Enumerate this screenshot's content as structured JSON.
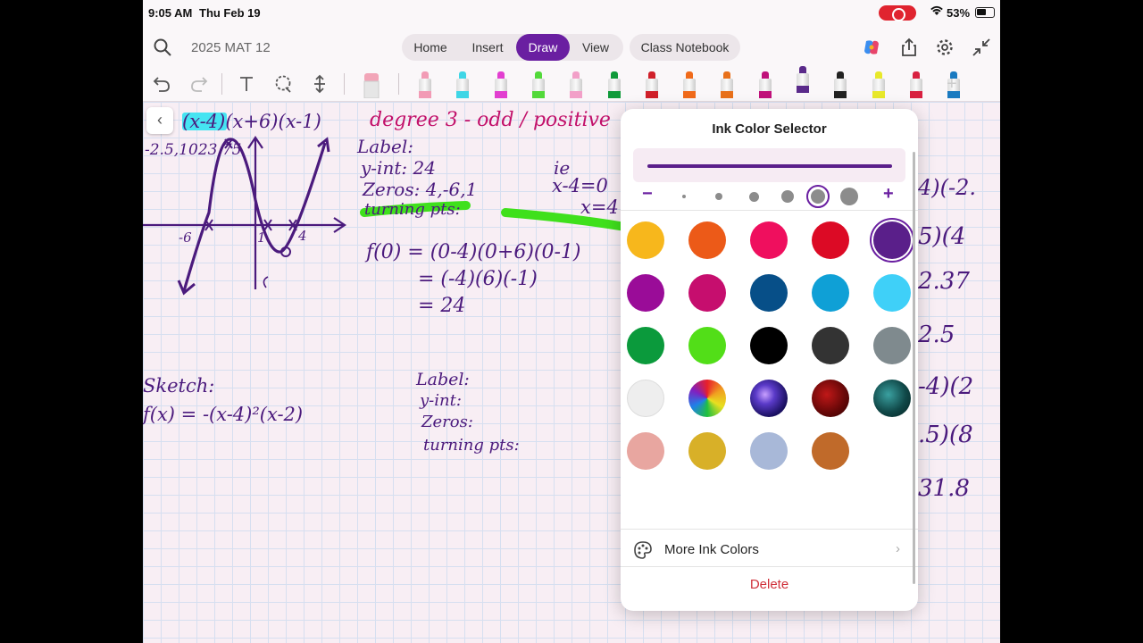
{
  "status": {
    "time": "9:05 AM",
    "date": "Thu Feb 19",
    "battery": "53%"
  },
  "header": {
    "notebook_title": "2025 MAT 12",
    "tabs": [
      {
        "label": "Home"
      },
      {
        "label": "Insert"
      },
      {
        "label": "Draw",
        "active": true
      },
      {
        "label": "View"
      }
    ],
    "class_notebook": "Class Notebook"
  },
  "toolbar": {
    "pens": [
      {
        "color": "#f29bb5"
      },
      {
        "color": "#3fd6e6"
      },
      {
        "color": "#e23fd0"
      },
      {
        "color": "#52d93a"
      },
      {
        "color": "#f2a0c8"
      },
      {
        "color": "#0f9a3a"
      },
      {
        "color": "#d0202a"
      },
      {
        "color": "#f06a1a"
      },
      {
        "color": "#e8701a"
      },
      {
        "color": "#c0107a"
      },
      {
        "color": "#5a2a8a",
        "selected": true
      },
      {
        "color": "#222222"
      },
      {
        "color": "#e8e82a"
      },
      {
        "color": "#d82040"
      },
      {
        "color": "#1a7ac0"
      }
    ]
  },
  "notes": {
    "equation_top": "(x-4)(x+6)(x-1)",
    "point": "-2.5,1023.75",
    "degree": "degree 3 - odd / positive",
    "label1": "Label:",
    "yint1": "y-int: 24",
    "zeros1": "Zeros: 4,-6,1",
    "turning1": "turning pts:",
    "ie": "ie",
    "ie_eq1": "x-4=0",
    "ie_eq2": "x=4",
    "f0_1": "f(0) = (0-4)(0+6)(0-1)",
    "f0_2": "= (-4)(6)(-1)",
    "f0_3": "= 24",
    "sketch": "Sketch:",
    "fx": "f(x) = -(x-4)²(x-2)",
    "label2": "Label:",
    "yint2": "y-int:",
    "zeros2": "Zeros:",
    "turning2": "turning pts:",
    "axis_neg6": "-6",
    "axis_1": "1",
    "axis_4": "4",
    "right_col": [
      "4)(-2.",
      "5)(4",
      "2.37",
      "2.5",
      "-4)(2",
      ".5)(8",
      "31.8"
    ]
  },
  "ink_popover": {
    "title": "Ink Color Selector",
    "preview_color": "#5a1f8a",
    "size_minus": "−",
    "size_plus": "+",
    "colors": [
      [
        "#f7b71c",
        "#ec5a18",
        "#ef0f5e",
        "#dc0a25",
        "#5a1f8a"
      ],
      [
        "#9a0c98",
        "#c60e6e",
        "#074f88",
        "#0fa0d6",
        "#3fd0f8"
      ],
      [
        "#0b9a3c",
        "#52de18",
        "#000000",
        "#333333",
        "#7f8a8e"
      ],
      [
        "#eeeeee",
        "rainbow",
        "galaxy",
        "darkred",
        "teal"
      ],
      [
        "#e8a6a0",
        "#d8b028",
        "#a8b8d8",
        "#c06a2a"
      ]
    ],
    "more_label": "More Ink Colors",
    "delete_label": "Delete"
  }
}
